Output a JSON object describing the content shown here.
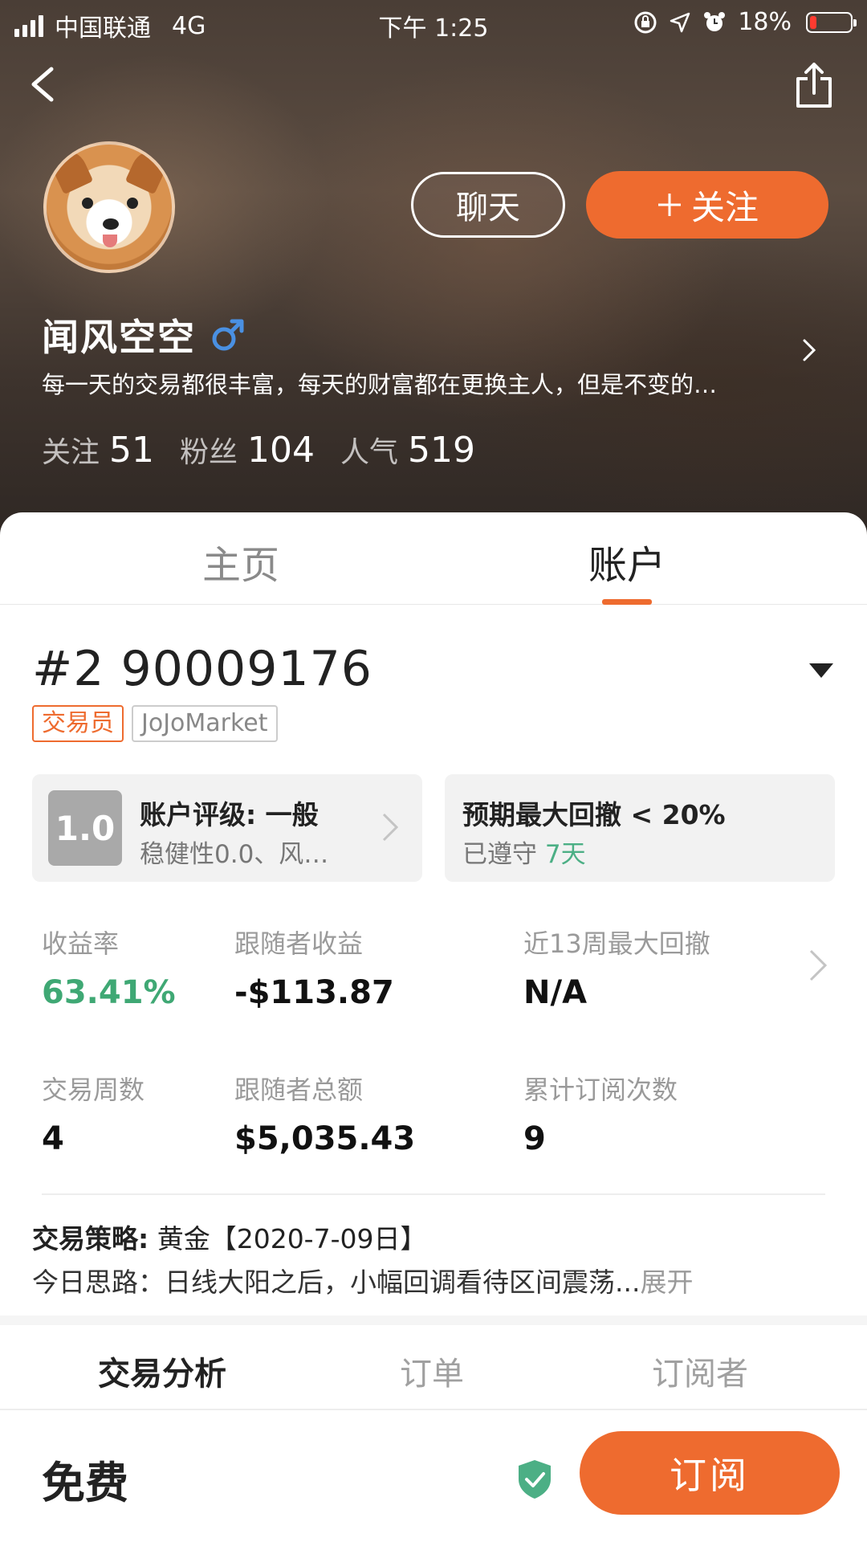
{
  "status_bar": {
    "carrier": "中国联通",
    "network": "4G",
    "time": "下午 1:25",
    "battery": "18%",
    "battery_color": "#ff3b30"
  },
  "header": {
    "back_icon": "chevron-left-icon",
    "share_icon": "share-icon",
    "chat_label": "聊天",
    "follow_label": "关注",
    "follow_icon": "plus-icon",
    "username": "闻风空空",
    "gender_icon": "male-icon",
    "bio": "每一天的交易都很丰富，每天的财富都在更换主人，但是不变的…",
    "stats": {
      "following_label": "关注",
      "following": "51",
      "fans_label": "粉丝",
      "fans": "104",
      "popularity_label": "人气",
      "popularity": "519"
    }
  },
  "tabs_top": {
    "home": "主页",
    "account": "账户"
  },
  "account": {
    "id": "#2 90009176",
    "tag_role": "交易员",
    "tag_broker": "JoJoMarket",
    "rating_score": "1.0",
    "rating_title": "账户评级: 一般",
    "rating_sub": "稳健性0.0、风…",
    "drawdown_title": "预期最大回撤 < 20%",
    "drawdown_kept": "已遵守",
    "drawdown_days": "7天"
  },
  "metrics": {
    "return_label": "收益率",
    "return_value": "63.41%",
    "follower_profit_label": "跟随者收益",
    "follower_profit_value": "-$113.87",
    "max_drawdown_label": "近13周最大回撤",
    "max_drawdown_value": "N/A",
    "weeks_label": "交易周数",
    "weeks_value": "4",
    "follower_total_label": "跟随者总额",
    "follower_total_value": "$5,035.43",
    "subs_label": "累计订阅次数",
    "subs_value": "9"
  },
  "strategy": {
    "label": "交易策略:",
    "text": "黄金【2020-7-09日】",
    "idea": "今日思路：日线大阳之后，小幅回调看待区间震荡...",
    "expand": "展开"
  },
  "tabs_bottom": {
    "analysis": "交易分析",
    "orders": "订单",
    "subscribers": "订阅者"
  },
  "footer": {
    "price": "免费",
    "subscribe": "订阅",
    "shield_icon": "shield-check-icon"
  },
  "colors": {
    "accent": "#ee6b2f",
    "positive": "#3fa874"
  }
}
